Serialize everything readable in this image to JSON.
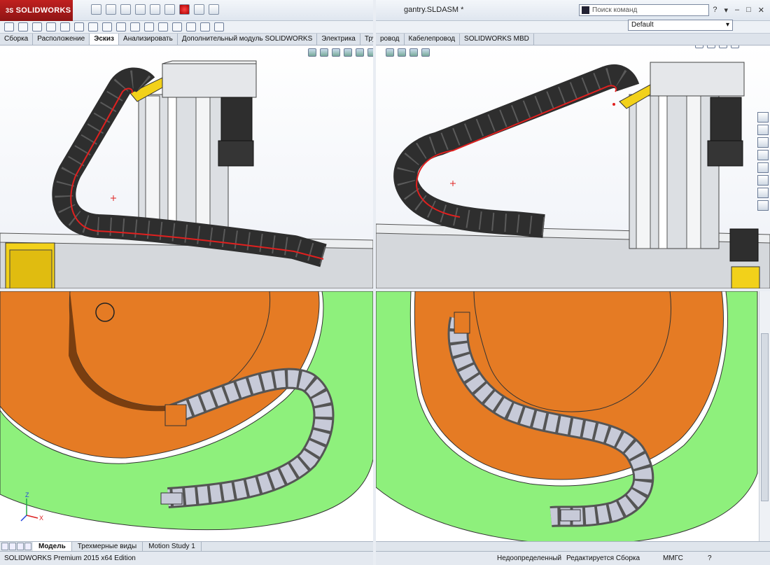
{
  "left_window": {
    "brand": "SOLIDWORKS",
    "brand_prefix": "3S",
    "tabs": [
      "Сборка",
      "Расположение",
      "Эскиз",
      "Анализировать",
      "Дополнительный модуль SOLIDWORKS",
      "Электрика",
      "Трубопровод"
    ],
    "active_tab": "Эскиз"
  },
  "right_window": {
    "title": "gantry.SLDASM *",
    "search_placeholder": "Поиск команд",
    "configuration": "Default",
    "window_controls": [
      "?",
      "▾",
      "–",
      "□",
      "✕"
    ],
    "tabs": [
      "ровод",
      "Кабелепровод",
      "SOLIDWORKS MBD"
    ]
  },
  "bottom_left": {
    "model_tabs": [
      "Модель",
      "Трехмерные виды",
      "Motion Study 1"
    ],
    "active_model_tab": "Модель",
    "status_text": "SOLIDWORKS Premium 2015 x64 Edition",
    "triad": {
      "z": "Z",
      "x": "X"
    }
  },
  "bottom_right": {
    "status_items": [
      "Недоопределенный",
      "Редактируется Сборка",
      "ММГС",
      "?"
    ]
  },
  "colors": {
    "chain": "#3a3a3a",
    "chain_light": "#c7cad8",
    "path": "#e0201f",
    "disk_orange": "#e57b24",
    "disk_green": "#8ef07c",
    "yellow": "#f2d11a",
    "steel": "#d8dbde"
  }
}
